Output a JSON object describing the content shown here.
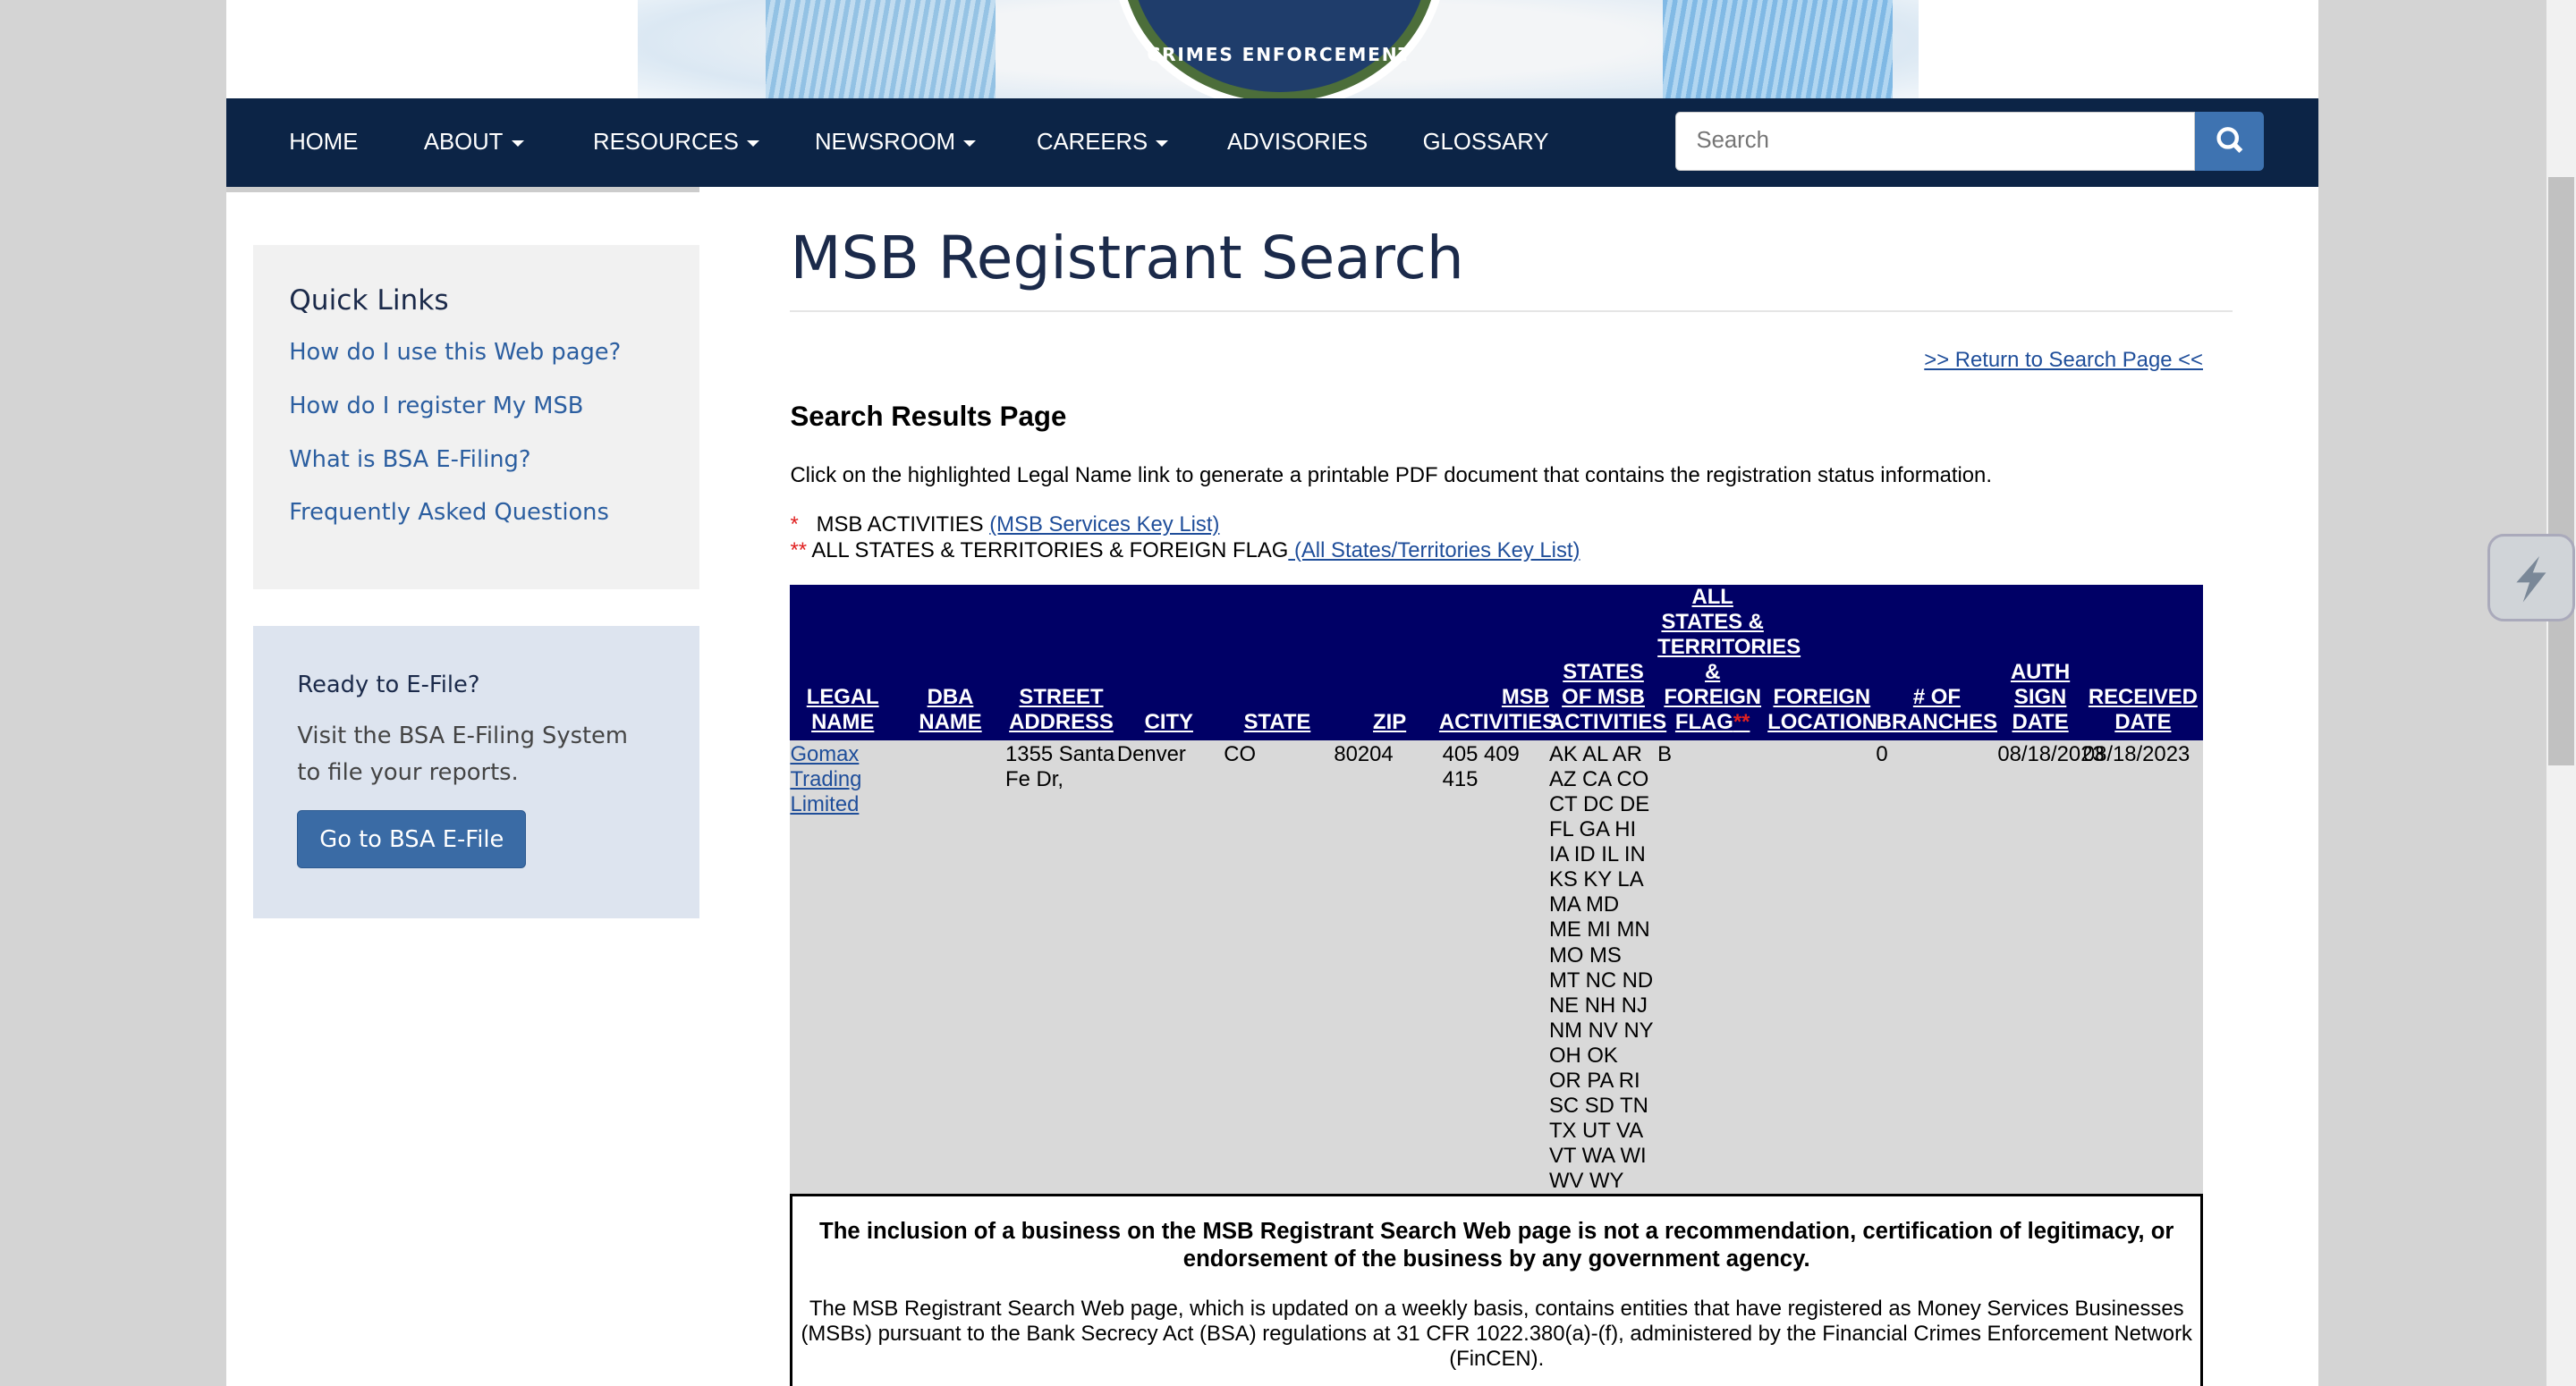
{
  "header": {
    "seal_text": "CRIMES ENFORCEMENT"
  },
  "nav": {
    "items": [
      {
        "label": "HOME",
        "dropdown": false
      },
      {
        "label": "ABOUT",
        "dropdown": true
      },
      {
        "label": "RESOURCES",
        "dropdown": true
      },
      {
        "label": "NEWSROOM",
        "dropdown": true
      },
      {
        "label": "CAREERS",
        "dropdown": true
      },
      {
        "label": "ADVISORIES",
        "dropdown": false
      },
      {
        "label": "GLOSSARY",
        "dropdown": false
      }
    ],
    "search_placeholder": "Search"
  },
  "sidebar": {
    "quick_links_title": "Quick Links",
    "links": [
      "How do I use this Web page?",
      "How do I register My MSB",
      "What is BSA E-Filing?",
      "Frequently Asked Questions"
    ],
    "efile_title": "Ready to E-File?",
    "efile_text": "Visit the BSA E-Filing System to file your reports.",
    "efile_button": "Go to BSA E-File"
  },
  "main": {
    "title": "MSB Registrant Search",
    "return_link": ">> Return to Search Page <<",
    "results_heading": "Search Results Page",
    "instructions": "Click on the highlighted Legal Name link to generate a printable PDF document that contains the registration status information.",
    "key1_mark": "*",
    "key1_label": "MSB ACTIVITIES ",
    "key1_link": "(MSB Services Key List)",
    "key2_mark": "**",
    "key2_label": "ALL STATES & TERRITORIES & FOREIGN FLAG",
    "key2_link": " (All States/Territories Key List)"
  },
  "table": {
    "headers": [
      "LEGAL NAME",
      "DBA NAME",
      "STREET ADDRESS",
      "CITY",
      "STATE",
      "ZIP",
      "MSB ACTIVITIES",
      "STATES OF MSB ACTIVITIES",
      "ALL STATES & TERRITORIES & FOREIGN FLAG",
      "FOREIGN LOCATION",
      "# OF BRANCHES",
      "AUTH SIGN DATE",
      "RECEIVED DATE"
    ],
    "rows": [
      {
        "legal_name": "Gomax Trading Limited",
        "dba_name": "",
        "street": "1355 Santa Fe Dr,",
        "city": "Denver",
        "state": "CO",
        "zip": "80204",
        "msb_activities": "405 409 415",
        "states": "AK AL AR AZ CA CO CT DC DE FL GA HI IA ID IL IN KS KY LA MA MD ME MI MN MO MS MT NC ND NE NH NJ NM NV NY OH OK OR PA RI SC SD TN TX UT VA VT WA WI WV WY",
        "all_states_flag": "B",
        "foreign_location": "",
        "branches": "0",
        "auth_sign_date": "08/18/2023",
        "received_date": "08/18/2023"
      }
    ]
  },
  "disclaimer": {
    "bold": "The inclusion of a business on the MSB Registrant Search Web page is not a recommendation, certification of legitimacy, or endorsement of the business by any government agency.",
    "text": "The MSB Registrant Search Web page, which is updated on a weekly basis, contains entities that have registered as Money Services Businesses (MSBs) pursuant to the Bank Secrecy Act (BSA) regulations at 31 CFR 1022.380(a)-(f), administered by the Financial Crimes Enforcement Network (FinCEN)."
  }
}
